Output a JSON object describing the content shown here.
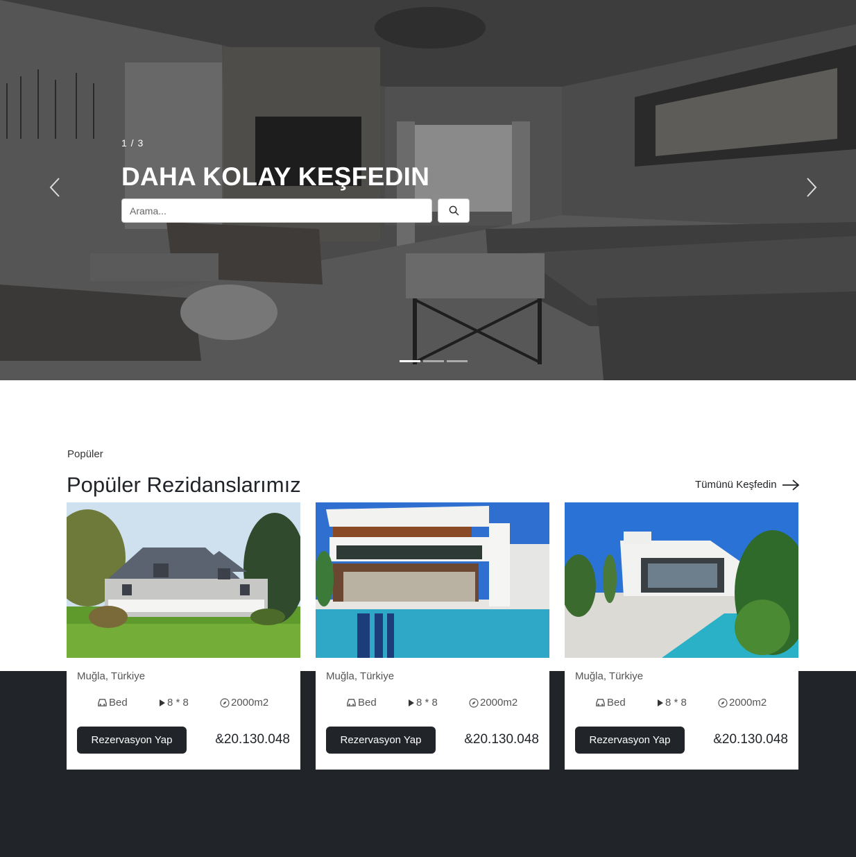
{
  "hero": {
    "counter": "1 / 3",
    "title": "DAHA KOLAY KEŞFEDIN",
    "search_placeholder": "Arama...",
    "search_icon": "search-icon",
    "prev_icon": "chevron-left-icon",
    "next_icon": "chevron-right-icon",
    "slides": 3,
    "active_slide": 1
  },
  "popular": {
    "eyebrow": "Popüler",
    "title": "Popüler Rezidanslarımız",
    "see_all": "Tümünü Keşfedin",
    "see_all_icon": "arrow-right-icon"
  },
  "cards": [
    {
      "location": "Muğla, Türkiye",
      "bed": "Bed",
      "size": "8 * 8",
      "area": "2000m2",
      "button": "Rezervasyon Yap",
      "price": "&20.130.048"
    },
    {
      "location": "Muğla, Türkiye",
      "bed": "Bed",
      "size": "8 * 8",
      "area": "2000m2",
      "button": "Rezervasyon Yap",
      "price": "&20.130.048"
    },
    {
      "location": "Muğla, Türkiye",
      "bed": "Bed",
      "size": "8 * 8",
      "area": "2000m2",
      "button": "Rezervasyon Yap",
      "price": "&20.130.048"
    }
  ],
  "colors": {
    "dark": "#212529",
    "white": "#ffffff"
  }
}
